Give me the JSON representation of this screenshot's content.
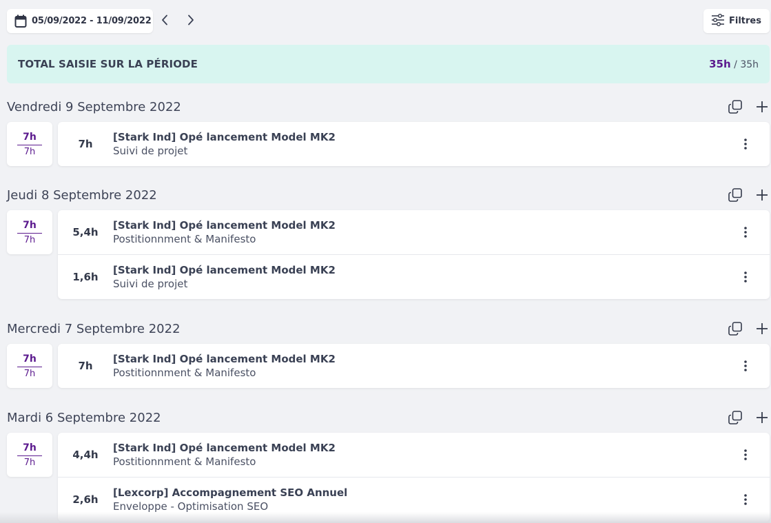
{
  "toolbar": {
    "date_range": "05/09/2022 - 11/09/2022",
    "filters_label": "Filtres"
  },
  "period_total": {
    "label": "TOTAL SAISIE SUR LA PÉRIODE",
    "entered": "35h",
    "separator": " / ",
    "expected": "35h"
  },
  "days": [
    {
      "title": "Vendredi 9 Septembre 2022",
      "total_entered": "7h",
      "total_expected": "7h",
      "entries": [
        {
          "hours": "7h",
          "project": "[Stark Ind] Opé lancement Model MK2",
          "task": "Suivi de projet"
        }
      ]
    },
    {
      "title": "Jeudi 8 Septembre 2022",
      "total_entered": "7h",
      "total_expected": "7h",
      "entries": [
        {
          "hours": "5,4h",
          "project": "[Stark Ind] Opé lancement Model MK2",
          "task": "Postitionnment & Manifesto"
        },
        {
          "hours": "1,6h",
          "project": "[Stark Ind] Opé lancement Model MK2",
          "task": "Suivi de projet"
        }
      ]
    },
    {
      "title": "Mercredi 7 Septembre 2022",
      "total_entered": "7h",
      "total_expected": "7h",
      "entries": [
        {
          "hours": "7h",
          "project": "[Stark Ind] Opé lancement Model MK2",
          "task": "Postitionnment & Manifesto"
        }
      ]
    },
    {
      "title": "Mardi 6 Septembre 2022",
      "total_entered": "7h",
      "total_expected": "7h",
      "entries": [
        {
          "hours": "4,4h",
          "project": "[Stark Ind] Opé lancement Model MK2",
          "task": "Postitionnment & Manifesto"
        },
        {
          "hours": "2,6h",
          "project": "[Lexcorp] Accompagnement SEO Annuel",
          "task": "Enveloppe - Optimisation SEO"
        }
      ]
    }
  ],
  "icons": {
    "calendar": "calendar-icon",
    "prev": "chevron-left-icon",
    "next": "chevron-right-icon",
    "filters": "sliders-icon",
    "copy": "copy-icon",
    "add": "plus-icon",
    "more": "more-vertical-icon"
  },
  "colors": {
    "background": "#f1f2f5",
    "banner": "#d8f5f0",
    "accent": "#5b1a8e",
    "card": "#ffffff",
    "text": "#33394a"
  }
}
